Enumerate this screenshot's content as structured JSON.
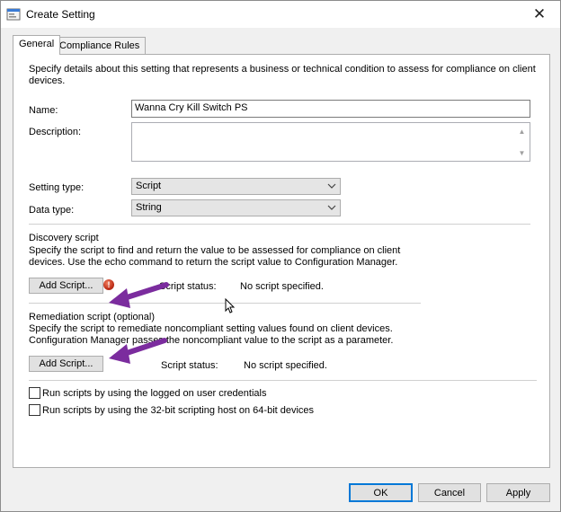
{
  "window": {
    "title": "Create Setting",
    "close_glyph": "✕"
  },
  "tabs": [
    {
      "label": "General",
      "active": true
    },
    {
      "label": "Compliance Rules",
      "active": false
    }
  ],
  "general": {
    "intro": "Specify details about this setting that represents a business or technical condition to assess for compliance on client devices.",
    "intro_line1": "Specify details about this setting that represents a business or technical condition to assess for compliance on client",
    "intro_line2": "devices.",
    "name_label": "Name:",
    "name_value": "Wanna Cry Kill Switch PS",
    "description_label": "Description:",
    "description_value": "",
    "setting_type_label": "Setting type:",
    "setting_type_value": "Script",
    "data_type_label": "Data type:",
    "data_type_value": "String"
  },
  "discovery": {
    "heading": "Discovery script",
    "desc_line1": "Specify the script to find and return the value to be assessed for compliance on client",
    "desc_line2": "devices. Use the echo command to return the script value to Configuration Manager.",
    "add_button": "Add Script...",
    "status_label": "Script status:",
    "status_value": "No script specified.",
    "error_icon_glyph": "!"
  },
  "remediation": {
    "heading": "Remediation script (optional)",
    "desc_line1": "Specify the script to remediate noncompliant setting values found on client devices.",
    "desc_line2": "Configuration Manager passes the noncompliant value to the script as a parameter.",
    "add_button": "Add Script...",
    "status_label": "Script status:",
    "status_value": "No script specified."
  },
  "options": {
    "run_logged_on": {
      "label": "Run scripts by using the logged on user credentials",
      "checked": false
    },
    "run_32bit": {
      "label": "Run scripts by using the 32-bit scripting host on 64-bit devices",
      "checked": false
    }
  },
  "footer": {
    "ok": "OK",
    "cancel": "Cancel",
    "apply": "Apply"
  },
  "colors": {
    "annotation_arrow": "#7b2c9e",
    "default_button_border": "#0078d7",
    "error_icon": "#c0301a"
  },
  "icons": {
    "app": "settings-window-icon",
    "close": "close-icon",
    "dropdown": "chevron-down-icon",
    "error": "error-icon",
    "arrow": "annotation-arrow",
    "cursor": "mouse-cursor-icon"
  }
}
